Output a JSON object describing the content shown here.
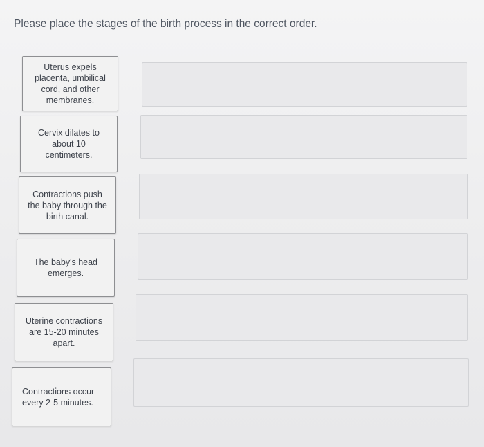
{
  "prompt": "Please place the stages of the birth process in the correct order.",
  "cards": [
    {
      "label": "Uterus expels\nplacenta, umbilical\ncord, and other\nmembranes."
    },
    {
      "label": "Cervix dilates to\nabout 10\ncentimeters."
    },
    {
      "label": "Contractions push\nthe baby through the\nbirth canal."
    },
    {
      "label": "The baby's head\nemerges."
    },
    {
      "label": "Uterine contractions\nare 15-20 minutes\napart."
    },
    {
      "label": "Contractions occur\nevery 2-5 minutes."
    }
  ],
  "drop_zones": [
    {
      "label": ""
    },
    {
      "label": ""
    },
    {
      "label": ""
    },
    {
      "label": ""
    },
    {
      "label": ""
    },
    {
      "label": ""
    }
  ]
}
